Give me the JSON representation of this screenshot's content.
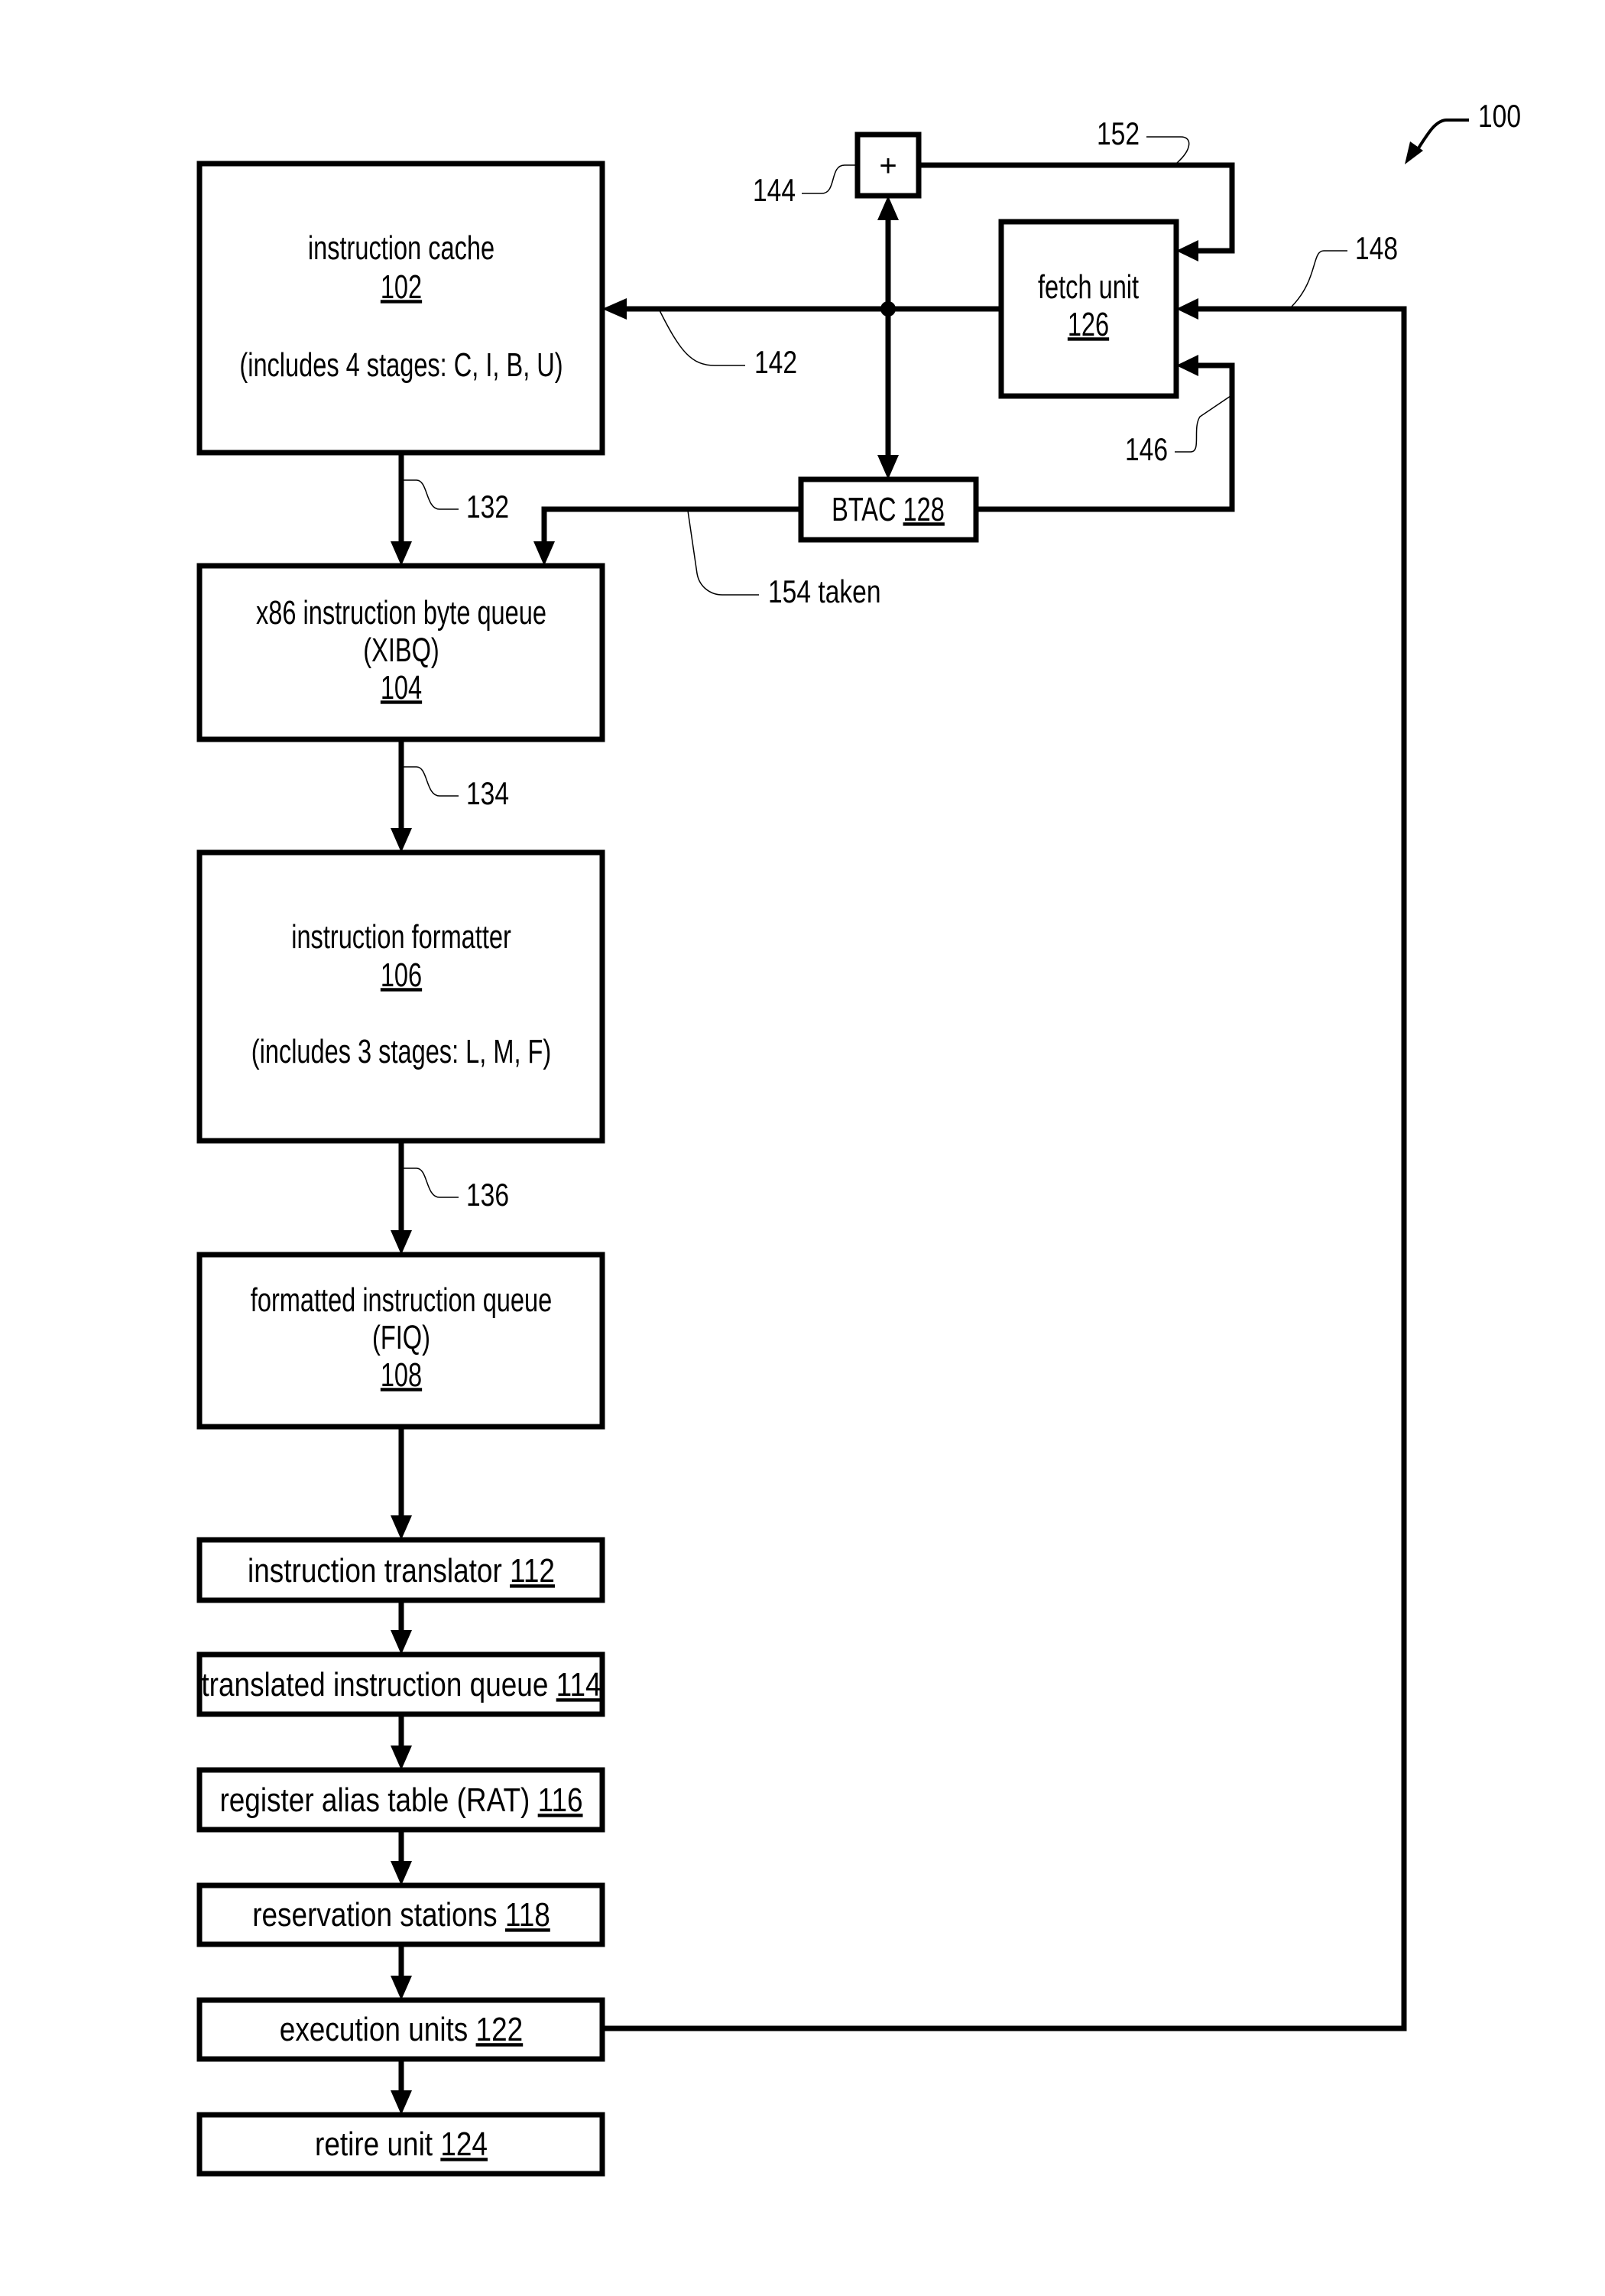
{
  "figure": {
    "reference": "100",
    "blocks": {
      "instruction_cache": {
        "name": "instruction cache",
        "ref": "102",
        "note": "(includes 4 stages: C, I, B, U)"
      },
      "xibq": {
        "name": "x86 instruction byte queue",
        "abbr": "(XIBQ)",
        "ref": "104"
      },
      "instruction_formatter": {
        "name": "instruction formatter",
        "ref": "106",
        "note": "(includes 3 stages: L, M, F)"
      },
      "fiq": {
        "name": "formatted instruction queue",
        "abbr": "(FIQ)",
        "ref": "108"
      },
      "instruction_translator": {
        "name": "instruction translator",
        "ref": "112"
      },
      "translated_instruction_queue": {
        "name": "translated instruction queue",
        "ref": "114"
      },
      "rat": {
        "name": "register alias table (RAT)",
        "ref": "116"
      },
      "reservation_stations": {
        "name": "reservation stations",
        "ref": "118"
      },
      "execution_units": {
        "name": "execution units",
        "ref": "122"
      },
      "retire_unit": {
        "name": "retire unit",
        "ref": "124"
      },
      "fetch_unit": {
        "name": "fetch unit",
        "ref": "126"
      },
      "btac": {
        "name": "BTAC",
        "ref": "128"
      },
      "adder": {
        "symbol": "+"
      }
    },
    "signals": {
      "s132": "132",
      "s134": "134",
      "s136": "136",
      "s142": "142",
      "s144": "144",
      "s146": "146",
      "s148": "148",
      "s152": "152",
      "s154": "154 taken"
    }
  }
}
